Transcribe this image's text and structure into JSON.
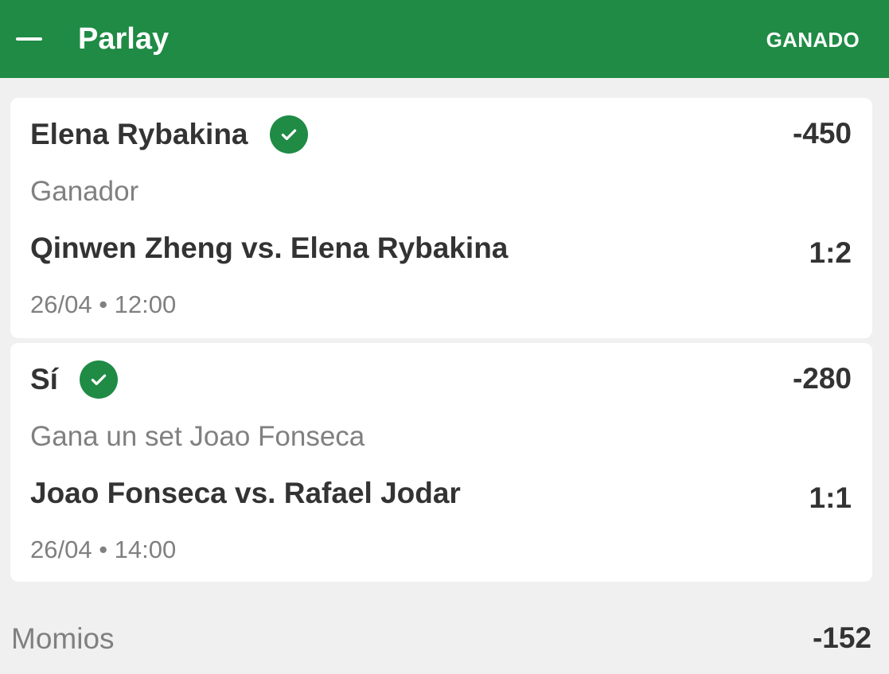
{
  "header": {
    "title": "Parlay",
    "status": "GANADO",
    "collapse_icon": "minus-icon",
    "background_color": "#1f8b45"
  },
  "legs": [
    {
      "selection": "Elena Rybakina",
      "status_icon": "check-circle-icon",
      "odds": "-450",
      "market": "Ganador",
      "event": "Qinwen Zheng vs. Elena Rybakina",
      "score": "1:2",
      "datetime": "26/04 • 12:00"
    },
    {
      "selection": "Sí",
      "status_icon": "check-circle-icon",
      "odds": "-280",
      "market": "Gana un set Joao Fonseca",
      "event": "Joao Fonseca vs. Rafael Jodar",
      "score": "1:1",
      "datetime": "26/04 • 14:00"
    }
  ],
  "footer": {
    "label": "Momios",
    "value": "-152"
  }
}
